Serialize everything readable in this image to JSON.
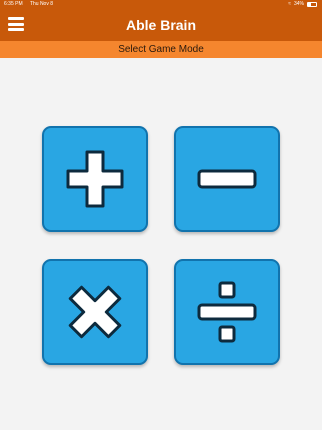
{
  "status_bar": {
    "time": "6:35 PM",
    "date": "Thu Nov 8",
    "battery": "34%",
    "icons": [
      "wifi-icon",
      "battery-icon"
    ]
  },
  "header": {
    "title": "Able Brain",
    "menu_icon": "hamburger-menu-icon"
  },
  "subheader": {
    "text": "Select Game Mode"
  },
  "modes": [
    {
      "name": "addition",
      "icon": "plus-icon"
    },
    {
      "name": "subtraction",
      "icon": "minus-icon"
    },
    {
      "name": "multiplication",
      "icon": "times-icon"
    },
    {
      "name": "division",
      "icon": "divide-icon"
    }
  ],
  "colors": {
    "header_bg": "#c8590a",
    "subheader_bg": "#f5862e",
    "button_bg": "#29a6e3",
    "button_border": "#1173ad",
    "icon_fill": "#ffffff",
    "icon_stroke": "#0d2a3d",
    "page_bg": "#f3f3f3"
  }
}
